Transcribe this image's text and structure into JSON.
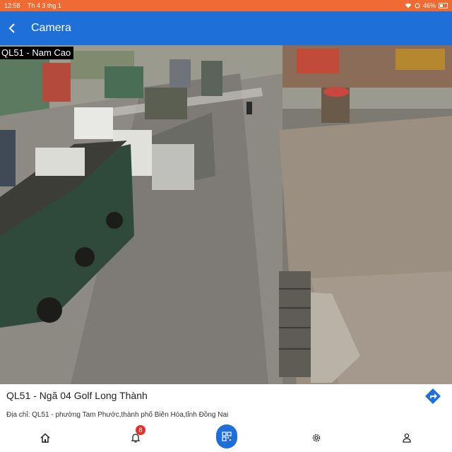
{
  "status_bar": {
    "time": "12:58",
    "date": "Th 4 3 thg 1",
    "battery": "46%"
  },
  "app_bar": {
    "title": "Camera",
    "back_icon": "back-arrow-icon"
  },
  "camera": {
    "label": "QL51 - Nam Cao"
  },
  "info": {
    "name": "QL51 - Ngã 04 Golf Long Thành",
    "address": "Địa chỉ: QL51 - phường Tam Phước,thành phố Biên Hòa,tỉnh Đồng Nai",
    "directions_icon": "directions-icon"
  },
  "bottom_nav": {
    "items": [
      {
        "icon": "home-icon"
      },
      {
        "icon": "bell-icon",
        "badge": "8"
      },
      {
        "icon": "qr-code-icon"
      },
      {
        "icon": "gear-icon"
      },
      {
        "icon": "person-icon"
      }
    ]
  },
  "colors": {
    "status_bar": "#f06a33",
    "app_bar": "#1f6fd8",
    "accent": "#1f6fd8",
    "badge": "#e0322b"
  }
}
